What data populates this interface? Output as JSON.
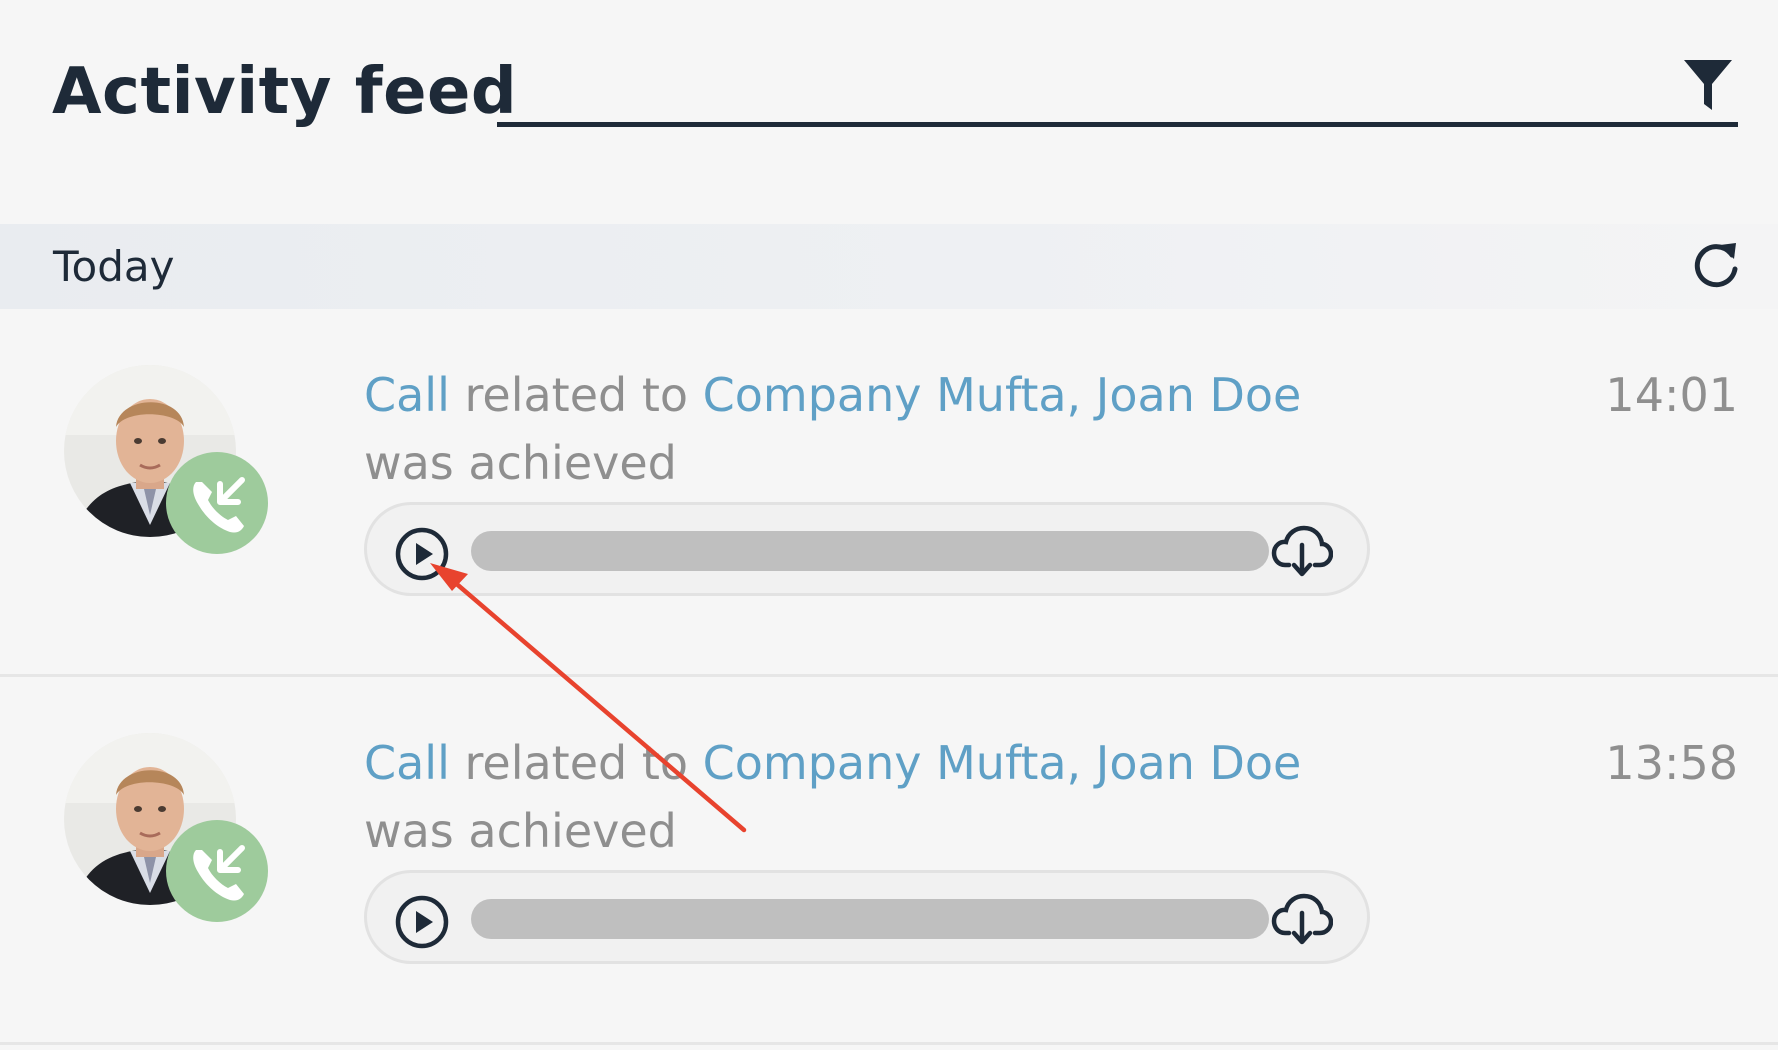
{
  "header": {
    "title": "Activity feed",
    "filter_icon": "filter-icon"
  },
  "section": {
    "label": "Today",
    "refresh_icon": "refresh-icon"
  },
  "activities": [
    {
      "type_link": "Call",
      "related_text": " related to ",
      "entity_link": "Company Mufta, Joan Doe",
      "status_text": " was achieved",
      "time": "14:01",
      "badge_icon": "incoming-call-icon",
      "player": {
        "play_icon": "play-icon",
        "download_icon": "cloud-download-icon",
        "progress": 0
      }
    },
    {
      "type_link": "Call",
      "related_text": " related to ",
      "entity_link": "Company Mufta, Joan Doe",
      "status_text": " was achieved",
      "time": "13:58",
      "badge_icon": "incoming-call-icon",
      "player": {
        "play_icon": "play-icon",
        "download_icon": "cloud-download-icon",
        "progress": 0
      }
    }
  ],
  "colors": {
    "title": "#1e2a38",
    "link": "#5fa0c6",
    "muted_text": "#8f8f8f",
    "badge": "#9ecb9c",
    "annotation_arrow": "#e8432e"
  }
}
